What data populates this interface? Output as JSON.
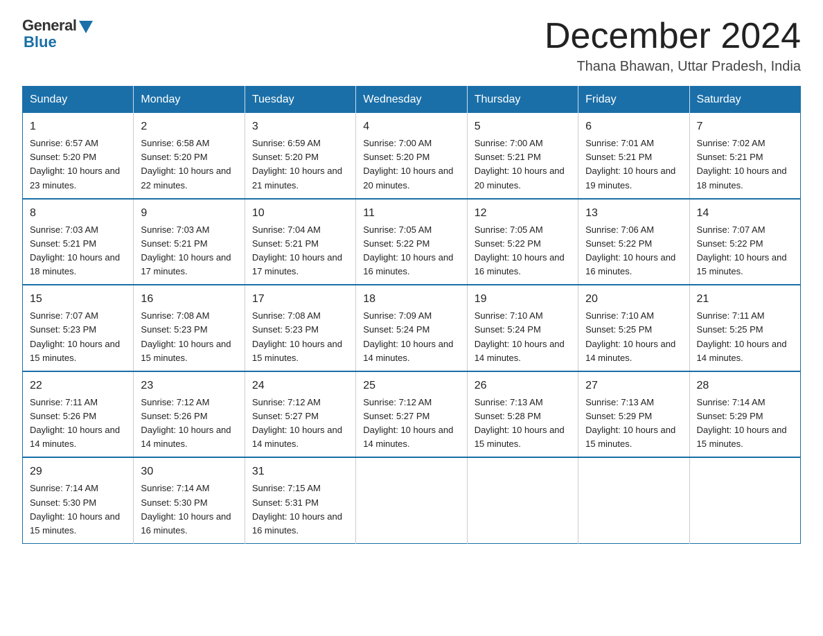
{
  "header": {
    "logo": {
      "general": "General",
      "blue": "Blue"
    },
    "title": "December 2024",
    "subtitle": "Thana Bhawan, Uttar Pradesh, India"
  },
  "calendar": {
    "days_of_week": [
      "Sunday",
      "Monday",
      "Tuesday",
      "Wednesday",
      "Thursday",
      "Friday",
      "Saturday"
    ],
    "weeks": [
      [
        {
          "day": "1",
          "sunrise": "6:57 AM",
          "sunset": "5:20 PM",
          "daylight": "10 hours and 23 minutes."
        },
        {
          "day": "2",
          "sunrise": "6:58 AM",
          "sunset": "5:20 PM",
          "daylight": "10 hours and 22 minutes."
        },
        {
          "day": "3",
          "sunrise": "6:59 AM",
          "sunset": "5:20 PM",
          "daylight": "10 hours and 21 minutes."
        },
        {
          "day": "4",
          "sunrise": "7:00 AM",
          "sunset": "5:20 PM",
          "daylight": "10 hours and 20 minutes."
        },
        {
          "day": "5",
          "sunrise": "7:00 AM",
          "sunset": "5:21 PM",
          "daylight": "10 hours and 20 minutes."
        },
        {
          "day": "6",
          "sunrise": "7:01 AM",
          "sunset": "5:21 PM",
          "daylight": "10 hours and 19 minutes."
        },
        {
          "day": "7",
          "sunrise": "7:02 AM",
          "sunset": "5:21 PM",
          "daylight": "10 hours and 18 minutes."
        }
      ],
      [
        {
          "day": "8",
          "sunrise": "7:03 AM",
          "sunset": "5:21 PM",
          "daylight": "10 hours and 18 minutes."
        },
        {
          "day": "9",
          "sunrise": "7:03 AM",
          "sunset": "5:21 PM",
          "daylight": "10 hours and 17 minutes."
        },
        {
          "day": "10",
          "sunrise": "7:04 AM",
          "sunset": "5:21 PM",
          "daylight": "10 hours and 17 minutes."
        },
        {
          "day": "11",
          "sunrise": "7:05 AM",
          "sunset": "5:22 PM",
          "daylight": "10 hours and 16 minutes."
        },
        {
          "day": "12",
          "sunrise": "7:05 AM",
          "sunset": "5:22 PM",
          "daylight": "10 hours and 16 minutes."
        },
        {
          "day": "13",
          "sunrise": "7:06 AM",
          "sunset": "5:22 PM",
          "daylight": "10 hours and 16 minutes."
        },
        {
          "day": "14",
          "sunrise": "7:07 AM",
          "sunset": "5:22 PM",
          "daylight": "10 hours and 15 minutes."
        }
      ],
      [
        {
          "day": "15",
          "sunrise": "7:07 AM",
          "sunset": "5:23 PM",
          "daylight": "10 hours and 15 minutes."
        },
        {
          "day": "16",
          "sunrise": "7:08 AM",
          "sunset": "5:23 PM",
          "daylight": "10 hours and 15 minutes."
        },
        {
          "day": "17",
          "sunrise": "7:08 AM",
          "sunset": "5:23 PM",
          "daylight": "10 hours and 15 minutes."
        },
        {
          "day": "18",
          "sunrise": "7:09 AM",
          "sunset": "5:24 PM",
          "daylight": "10 hours and 14 minutes."
        },
        {
          "day": "19",
          "sunrise": "7:10 AM",
          "sunset": "5:24 PM",
          "daylight": "10 hours and 14 minutes."
        },
        {
          "day": "20",
          "sunrise": "7:10 AM",
          "sunset": "5:25 PM",
          "daylight": "10 hours and 14 minutes."
        },
        {
          "day": "21",
          "sunrise": "7:11 AM",
          "sunset": "5:25 PM",
          "daylight": "10 hours and 14 minutes."
        }
      ],
      [
        {
          "day": "22",
          "sunrise": "7:11 AM",
          "sunset": "5:26 PM",
          "daylight": "10 hours and 14 minutes."
        },
        {
          "day": "23",
          "sunrise": "7:12 AM",
          "sunset": "5:26 PM",
          "daylight": "10 hours and 14 minutes."
        },
        {
          "day": "24",
          "sunrise": "7:12 AM",
          "sunset": "5:27 PM",
          "daylight": "10 hours and 14 minutes."
        },
        {
          "day": "25",
          "sunrise": "7:12 AM",
          "sunset": "5:27 PM",
          "daylight": "10 hours and 14 minutes."
        },
        {
          "day": "26",
          "sunrise": "7:13 AM",
          "sunset": "5:28 PM",
          "daylight": "10 hours and 15 minutes."
        },
        {
          "day": "27",
          "sunrise": "7:13 AM",
          "sunset": "5:29 PM",
          "daylight": "10 hours and 15 minutes."
        },
        {
          "day": "28",
          "sunrise": "7:14 AM",
          "sunset": "5:29 PM",
          "daylight": "10 hours and 15 minutes."
        }
      ],
      [
        {
          "day": "29",
          "sunrise": "7:14 AM",
          "sunset": "5:30 PM",
          "daylight": "10 hours and 15 minutes."
        },
        {
          "day": "30",
          "sunrise": "7:14 AM",
          "sunset": "5:30 PM",
          "daylight": "10 hours and 16 minutes."
        },
        {
          "day": "31",
          "sunrise": "7:15 AM",
          "sunset": "5:31 PM",
          "daylight": "10 hours and 16 minutes."
        },
        null,
        null,
        null,
        null
      ]
    ]
  }
}
